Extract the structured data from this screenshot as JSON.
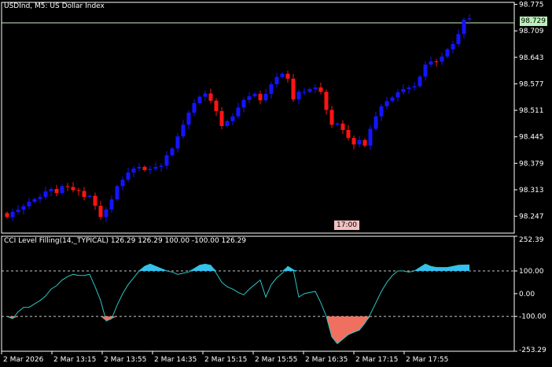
{
  "chart_title": "USDInd, M5:  US Dollar Index",
  "indicator_title": "CCI Level Filling(14,_TYPICAL) 126.29 126.29 100.00 -100.00 126.29",
  "current_price_label": "98.729",
  "time_marker_label": "17:00",
  "colors": {
    "background": "#000000",
    "bull": "#1414ff",
    "bear": "#ff1414",
    "cci_line": "#2ec4c4",
    "fill_above": "#36c0f0",
    "fill_below": "#f07060",
    "level_line": "#c8c8c8",
    "price_line": "#c8f0c8"
  },
  "chart_data": [
    {
      "type": "candlestick",
      "title": "USDInd, M5:  US Dollar Index",
      "ylim": [
        98.205,
        98.78
      ],
      "y_ticks": [
        "98.775",
        "98.709",
        "98.643",
        "98.577",
        "98.511",
        "98.445",
        "98.379",
        "98.313",
        "98.247"
      ],
      "x_ticks": [
        "2 Mar 2026",
        "2 Mar 13:15",
        "2 Mar 13:55",
        "2 Mar 14:35",
        "2 Mar 15:15",
        "2 Mar 15:55",
        "2 Mar 16:35",
        "2 Mar 17:15",
        "2 Mar 17:55"
      ],
      "last_price": 98.729,
      "close": [
        98.245,
        98.258,
        98.263,
        98.272,
        98.283,
        98.29,
        98.295,
        98.309,
        98.315,
        98.305,
        98.322,
        98.32,
        98.312,
        98.31,
        98.295,
        98.298,
        98.273,
        98.245,
        98.264,
        98.289,
        98.322,
        98.338,
        98.356,
        98.366,
        98.37,
        98.362,
        98.365,
        98.37,
        98.373,
        98.399,
        98.416,
        98.446,
        98.475,
        98.505,
        98.529,
        98.545,
        98.553,
        98.535,
        98.509,
        98.472,
        98.484,
        98.496,
        98.518,
        98.537,
        98.546,
        98.552,
        98.536,
        98.552,
        98.576,
        98.594,
        98.602,
        98.59,
        98.538,
        98.557,
        98.557,
        98.564,
        98.568,
        98.557,
        98.512,
        98.475,
        98.478,
        98.462,
        98.442,
        98.426,
        98.437,
        98.423,
        98.465,
        98.496,
        98.521,
        98.534,
        98.543,
        98.556,
        98.564,
        98.568,
        98.571,
        98.595,
        98.625,
        98.633,
        98.632,
        98.645,
        98.663,
        98.676,
        98.701,
        98.737,
        98.74
      ],
      "series": [
        {
          "name": "CCI Level Filling(14,_TYPICAL)",
          "values": [
            -100,
            -110,
            -80,
            -60,
            -60,
            -45,
            -30,
            -10,
            20,
            35,
            60,
            75,
            85,
            80,
            80,
            85,
            30,
            -30,
            -120,
            -110,
            -50,
            0,
            40,
            70,
            100,
            120,
            130,
            120,
            110,
            100,
            95,
            85,
            90,
            95,
            110,
            125,
            130,
            125,
            90,
            50,
            30,
            20,
            5,
            -5,
            20,
            40,
            60,
            -15,
            40,
            70,
            90,
            120,
            105,
            -15,
            0,
            5,
            10,
            -40,
            -100,
            -190,
            -220,
            -200,
            -180,
            -170,
            -160,
            -130,
            -90,
            -40,
            10,
            50,
            80,
            100,
            100,
            95,
            100,
            115,
            130,
            120,
            115,
            115,
            115,
            120,
            125,
            126,
            126.29
          ]
        }
      ],
      "indicator_ylim": [
        -253.29,
        252.39
      ],
      "indicator_ticks": [
        "252.39",
        "100.00",
        "0.00",
        "-100.00",
        "-253.29"
      ],
      "levels": [
        100,
        -100
      ]
    }
  ]
}
